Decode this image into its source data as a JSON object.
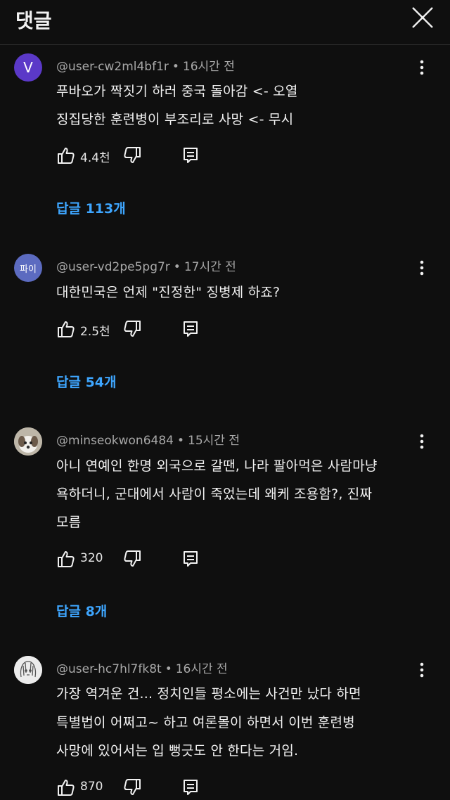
{
  "header": {
    "title": "댓글"
  },
  "colors": {
    "accent": "#3ea6ff",
    "background": "#0f0f0f",
    "meta": "#a8a8a8"
  },
  "comments": [
    {
      "avatar": {
        "type": "letter",
        "text": "V",
        "color": "#5b39c8"
      },
      "author": "@user-cw2ml4bf1r",
      "time": "16시간 전",
      "lines": [
        "푸바오가 짝짓기 하러 중국 돌아감 <- 오열",
        "징집당한 훈련병이 부조리로 사망 <- 무시"
      ],
      "likes": "4.4천",
      "replies": "답글 113개"
    },
    {
      "avatar": {
        "type": "text",
        "text": "파이",
        "color": "#5c6bc0"
      },
      "author": "@user-vd2pe5pg7r",
      "time": "17시간 전",
      "lines": [
        "대한민국은 언제 \"진정한\" 징병제 하죠?"
      ],
      "likes": "2.5천",
      "replies": "답글 54개"
    },
    {
      "avatar": {
        "type": "image",
        "text": "dog-photo"
      },
      "author": "@minseokwon6484",
      "time": "15시간 전",
      "lines": [
        "아니 연예인 한명 외국으로 갈땐, 나라 팔아먹은 사람마냥",
        "욕하더니, 군대에서 사람이 죽었는데 왜케 조용함?, 진짜",
        "모름"
      ],
      "likes": "320",
      "replies": "답글 8개"
    },
    {
      "avatar": {
        "type": "image",
        "text": "drawing-portrait"
      },
      "author": "@user-hc7hl7fk8t",
      "time": "16시간 전",
      "lines": [
        "가장 역겨운 건... 정치인들 평소에는 사건만 났다 하면",
        "특별법이 어쩌고~ 하고 여론몰이 하면서 이번 훈련병",
        "사망에 있어서는 입 뻥긋도 안 한다는 거임."
      ],
      "likes": "870",
      "replies": ""
    }
  ],
  "icons": {
    "close": "close-icon",
    "more": "more-vertical-icon",
    "like": "thumbs-up-icon",
    "dislike": "thumbs-down-icon",
    "reply": "reply-comment-icon"
  }
}
